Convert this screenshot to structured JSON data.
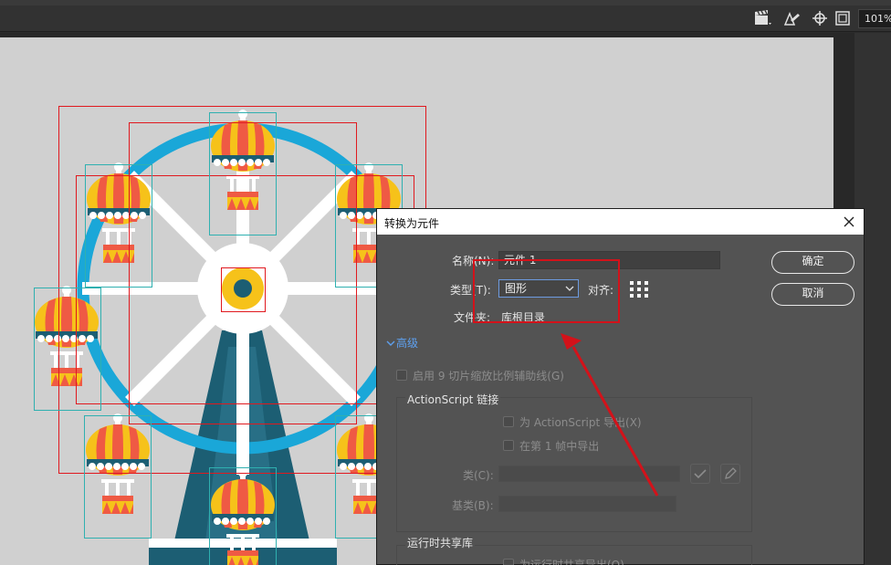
{
  "toolbar": {
    "zoom": "101%",
    "icons": [
      "clapper-icon",
      "pen-edit-icon",
      "crosshair-icon",
      "frame-icon"
    ]
  },
  "dialog": {
    "title": "转换为元件",
    "name_label": "名称(N):",
    "name_value": "元件 1",
    "type_label": "类型(T):",
    "type_value": "图形",
    "align_label": "对齐:",
    "folder_label": "文件夹:",
    "folder_value": "库根目录",
    "ok_label": "确定",
    "cancel_label": "取消",
    "advanced_label": "高级",
    "nine_slice_label": "启用 9 切片缩放比例辅助线(G)",
    "actionscript": {
      "title": "ActionScript 链接",
      "export_label": "为 ActionScript 导出(X)",
      "frame1_label": "在第 1 帧中导出",
      "class_label": "类(C):",
      "base_label": "基类(B):"
    },
    "runtime": {
      "title": "运行时共享库",
      "export_label": "为运行时共享导出(O)"
    }
  },
  "colors": {
    "stage_bg": "#d0d0d0",
    "wheel_blue": "#1aa7d8",
    "tower_dark": "#1c5e73",
    "balloon_yellow": "#f6c21a",
    "balloon_red": "#ef5a44",
    "selection_red": "#e0191f",
    "bbox_cyan": "#2fb0b0",
    "annotation_red": "#d3121a",
    "link_blue": "#5ea0ef"
  }
}
